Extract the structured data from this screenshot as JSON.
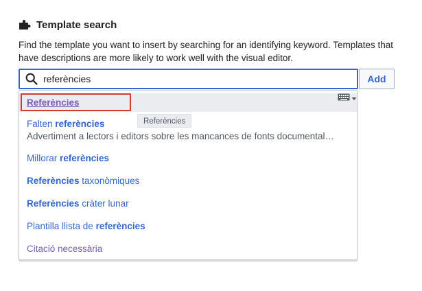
{
  "dialog": {
    "title": "Template search",
    "description": "Find the template you want to insert by searching for an identifying keyword. Templates that have descriptions are more likely to work well with the visual editor."
  },
  "search": {
    "value": "referències",
    "add_label": "Add"
  },
  "suggestions": [
    {
      "pre": "",
      "bold": "Referències",
      "post": "",
      "description": ""
    },
    {
      "pre": "Falten ",
      "bold": "referències",
      "post": "",
      "description": "Advertiment a lectors i editors sobre les mancances de fonts documental…"
    },
    {
      "pre": "Millorar ",
      "bold": "referències",
      "post": "",
      "description": ""
    },
    {
      "pre": "",
      "bold": "Referències",
      "post": " taxonòmiques",
      "description": ""
    },
    {
      "pre": "",
      "bold": "Referències",
      "post": " cràter lunar",
      "description": ""
    },
    {
      "pre": "Plantilla llista de ",
      "bold": "referències",
      "post": "",
      "description": ""
    },
    {
      "pre": "Citació necessària",
      "bold": "",
      "post": "",
      "description": ""
    }
  ],
  "tooltip": {
    "text": "Referències"
  },
  "icons": {
    "title_icon": "puzzle-piece-icon",
    "search_icon": "search-icon",
    "keyboard_icon": "keyboard-icon"
  },
  "colors": {
    "link": "#3366cc",
    "visited": "#795cb2",
    "focus_border": "#3366cc",
    "annotation_box": "#d33a2c"
  }
}
